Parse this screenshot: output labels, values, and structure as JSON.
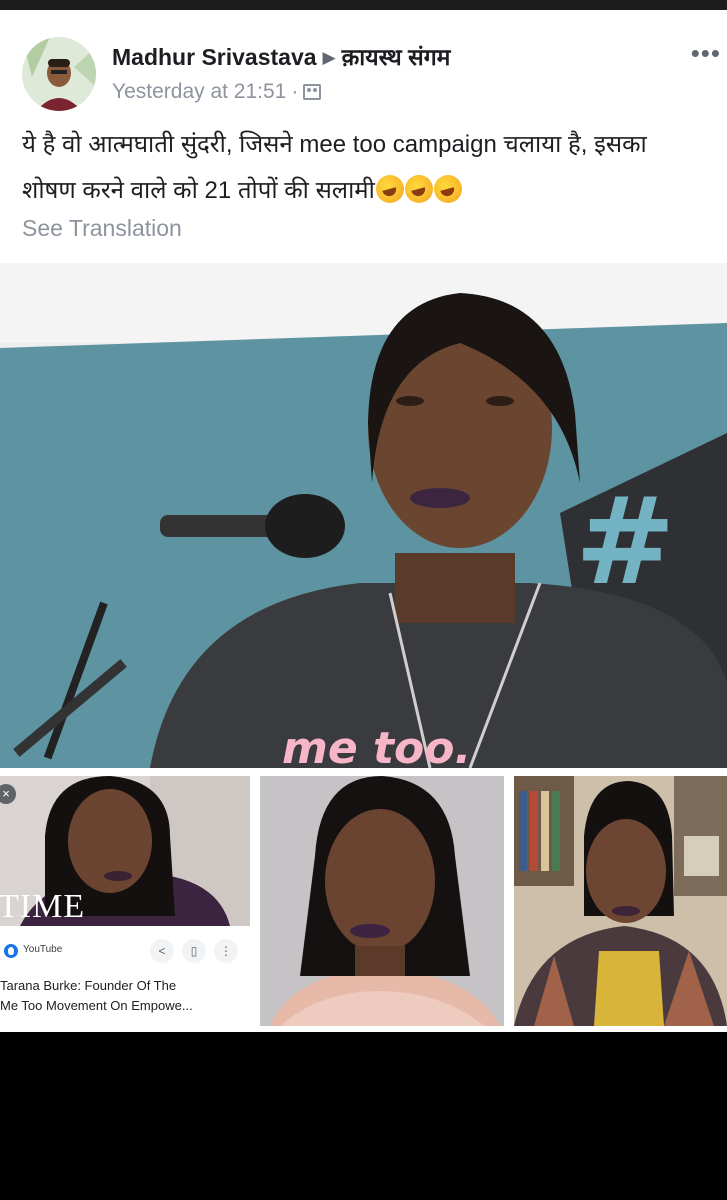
{
  "post": {
    "author": "Madhur Srivastava",
    "arrow": "▶",
    "group": "क़ायस्थ संगम",
    "more": "•••",
    "time": "Yesterday at 21:51",
    "dot": "·",
    "text_line1": "ये है वो आत्मघाती सुंदरी, जिसने mee too campaign चलाया है, इसका",
    "text_line2": "शोषण करने वाले को 21 तोपों की सलामी",
    "see_translation": "See Translation"
  },
  "main_image": {
    "shirt_text": "me too.",
    "banner_symbol": "#"
  },
  "results": {
    "close": "×",
    "time_logo": "TIME",
    "source": "YouTube",
    "share_icon": "<",
    "save_icon": "▯",
    "more_icon": "⋮",
    "title_line1": "Tarana Burke: Founder Of The",
    "title_line2": "Me Too Movement On Empowe..."
  },
  "colors": {
    "banner": "#5e93a2",
    "shirt_text": "#f7b5c8",
    "link_grey": "#8d949e"
  }
}
